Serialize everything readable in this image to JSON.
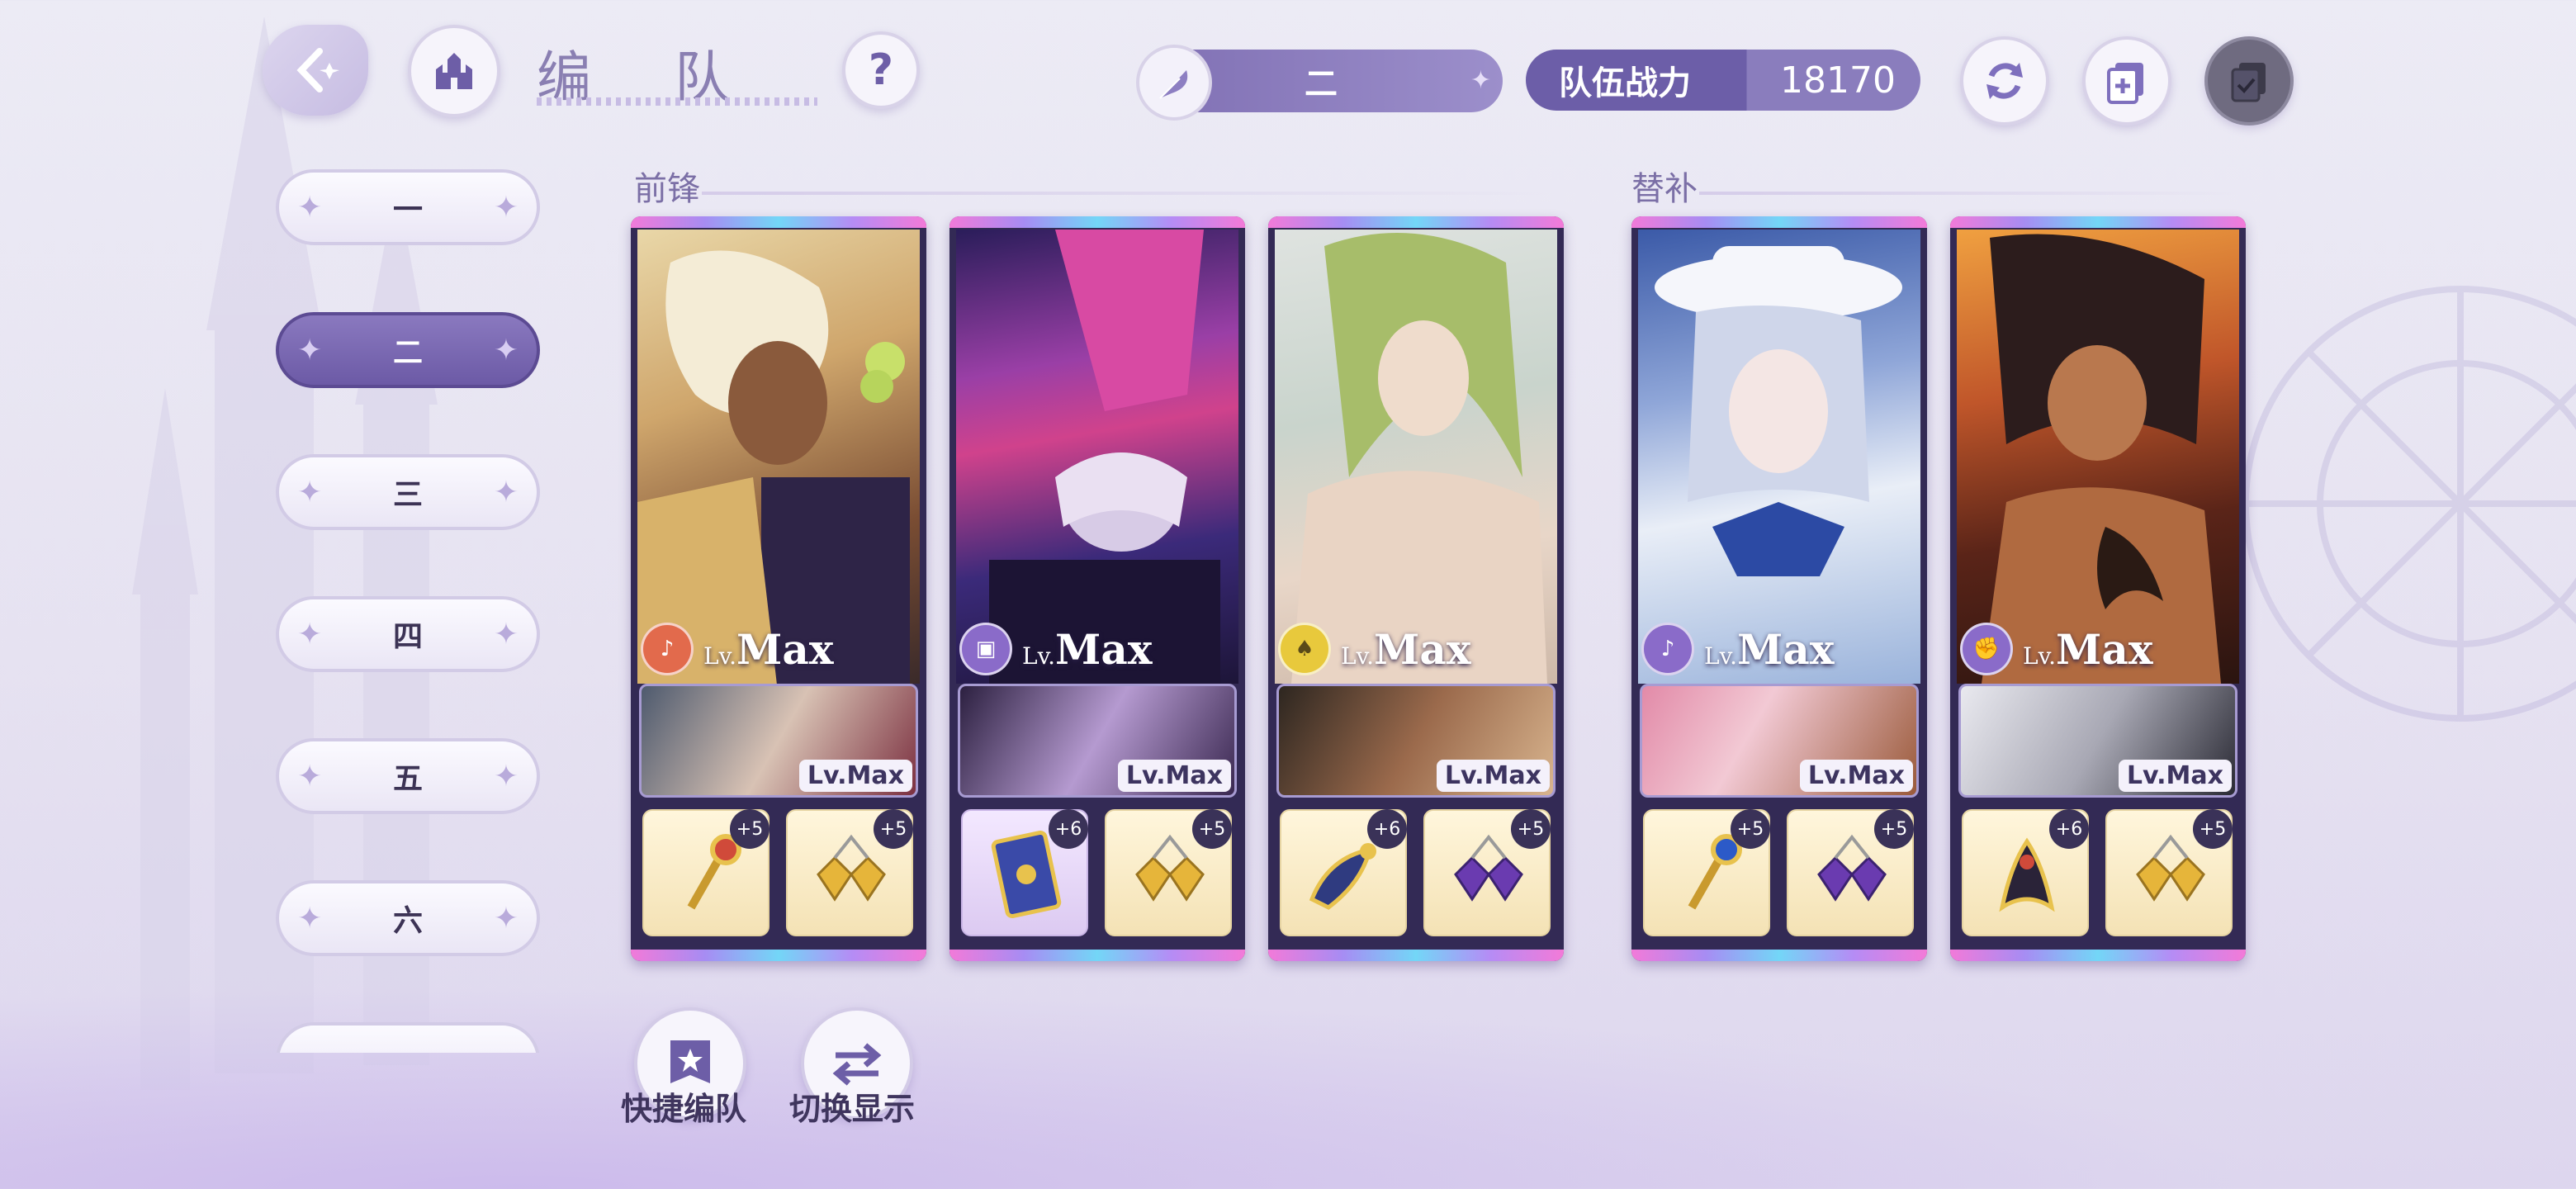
{
  "header": {
    "title": "编 队",
    "team_selector": {
      "value": "二"
    },
    "power": {
      "label": "队伍战力",
      "value": "18170"
    },
    "icons": [
      "back-icon",
      "castle-icon",
      "help-icon",
      "refresh-icon",
      "add-team-icon",
      "confirm-icon"
    ]
  },
  "sidebar": {
    "tabs": [
      {
        "label": "一",
        "active": false
      },
      {
        "label": "二",
        "active": true
      },
      {
        "label": "三",
        "active": false
      },
      {
        "label": "四",
        "active": false
      },
      {
        "label": "五",
        "active": false
      },
      {
        "label": "六",
        "active": false
      },
      {
        "label": "",
        "active": false
      }
    ]
  },
  "sections": {
    "front": "前锋",
    "sub": "替补"
  },
  "cards": [
    {
      "lv_prefix": "Lv.",
      "lv": "Max",
      "element_color": "#e26a4c",
      "element_icon": "mic-icon",
      "support_lv": "Lv.Max",
      "equip": [
        {
          "plus": "+5",
          "icon": "scepter-icon"
        },
        {
          "plus": "+5",
          "icon": "gem-pair-icon"
        }
      ]
    },
    {
      "lv_prefix": "Lv.",
      "lv": "Max",
      "element_color": "#8a6bc9",
      "element_icon": "book-icon",
      "support_lv": "Lv.Max",
      "equip": [
        {
          "plus": "+6",
          "icon": "card-icon"
        },
        {
          "plus": "+5",
          "icon": "gem-pair-icon"
        }
      ]
    },
    {
      "lv_prefix": "Lv.",
      "lv": "Max",
      "element_color": "#e8c93c",
      "element_icon": "hat-icon",
      "support_lv": "Lv.Max",
      "equip": [
        {
          "plus": "+6",
          "icon": "ornament-icon"
        },
        {
          "plus": "+5",
          "icon": "gem-pair-icon"
        }
      ]
    },
    {
      "lv_prefix": "Lv.",
      "lv": "Max",
      "element_color": "#8a6bc9",
      "element_icon": "mic-icon",
      "support_lv": "Lv.Max",
      "equip": [
        {
          "plus": "+5",
          "icon": "scepter-icon"
        },
        {
          "plus": "+5",
          "icon": "gem-pair-icon"
        }
      ]
    },
    {
      "lv_prefix": "Lv.",
      "lv": "Max",
      "element_color": "#8a6bc9",
      "element_icon": "fist-icon",
      "support_lv": "Lv.Max",
      "equip": [
        {
          "plus": "+6",
          "icon": "ornament-icon"
        },
        {
          "plus": "+5",
          "icon": "gem-pair-icon"
        }
      ]
    }
  ],
  "bottom": {
    "quick_label": "快捷编队",
    "switch_label": "切换显示"
  }
}
